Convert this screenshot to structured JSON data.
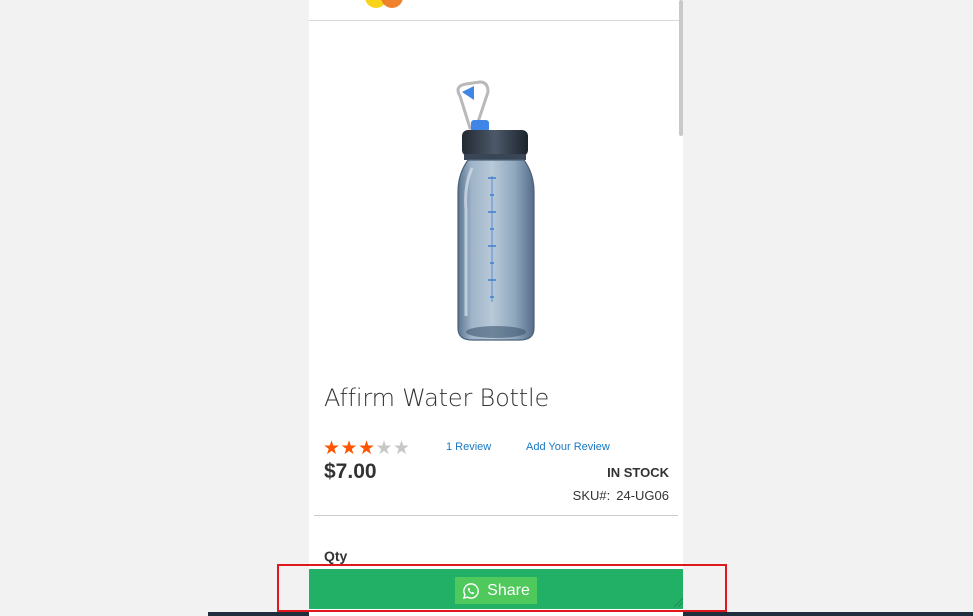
{
  "product": {
    "name": "Affirm Water Bottle",
    "rating": {
      "value": 3,
      "max": 5
    },
    "review_count_link": "1  Review",
    "add_review_link": "Add Your Review",
    "price": "$7.00",
    "stock_status": "IN STOCK",
    "sku_label": "SKU#:",
    "sku_value": "24-UG06"
  },
  "form": {
    "qty_label": "Qty"
  },
  "share_widget": {
    "button_label": "Share",
    "icon": "whatsapp-icon",
    "bar_color": "#22b067",
    "button_color": "#4fc85c"
  },
  "colors": {
    "star_filled": "#ff5501",
    "star_empty": "#c7c7c7",
    "link": "#1979c3",
    "highlight": "#e0181e"
  }
}
